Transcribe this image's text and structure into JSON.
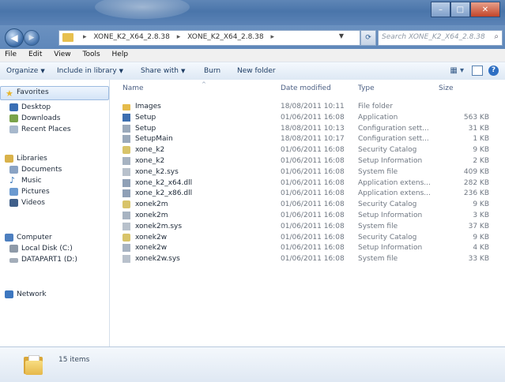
{
  "window": {
    "controls": {
      "minimize": "–",
      "maximize": "□",
      "close": "✕"
    }
  },
  "address": {
    "crumbs": [
      "XONE_K2_X64_2.8.38",
      "XONE_K2_X64_2.8.38"
    ],
    "search_placeholder": "Search XONE_K2_X64_2.8.38"
  },
  "menu": [
    "File",
    "Edit",
    "View",
    "Tools",
    "Help"
  ],
  "commands": {
    "organize": "Organize",
    "include_in_library": "Include in library",
    "share_with": "Share with",
    "burn": "Burn",
    "new_folder": "New folder"
  },
  "nav": {
    "favorites": "Favorites",
    "desktop": "Desktop",
    "downloads": "Downloads",
    "recent_places": "Recent Places",
    "libraries": "Libraries",
    "documents": "Documents",
    "music": "Music",
    "pictures": "Pictures",
    "videos": "Videos",
    "computer": "Computer",
    "local_disk": "Local Disk (C:)",
    "datapart": "DATAPART1 (D:)",
    "network": "Network"
  },
  "columns": {
    "name": "Name",
    "date": "Date modified",
    "type": "Type",
    "size": "Size"
  },
  "files": [
    {
      "name": "Images",
      "date": "18/08/2011 10:11",
      "type": "File folder",
      "size": "",
      "icon": "folder"
    },
    {
      "name": "Setup",
      "date": "01/06/2011 16:08",
      "type": "Application",
      "size": "563 KB",
      "icon": "application"
    },
    {
      "name": "Setup",
      "date": "18/08/2011 10:13",
      "type": "Configuration sett...",
      "size": "31 KB",
      "icon": "config"
    },
    {
      "name": "SetupMain",
      "date": "18/08/2011 10:17",
      "type": "Configuration sett...",
      "size": "1 KB",
      "icon": "config"
    },
    {
      "name": "xone_k2",
      "date": "01/06/2011 16:08",
      "type": "Security Catalog",
      "size": "9 KB",
      "icon": "catalog"
    },
    {
      "name": "xone_k2",
      "date": "01/06/2011 16:08",
      "type": "Setup Information",
      "size": "2 KB",
      "icon": "setupinfo"
    },
    {
      "name": "xone_k2.sys",
      "date": "01/06/2011 16:08",
      "type": "System file",
      "size": "409 KB",
      "icon": "sysfile"
    },
    {
      "name": "xone_k2_x64.dll",
      "date": "01/06/2011 16:08",
      "type": "Application extens...",
      "size": "282 KB",
      "icon": "dll"
    },
    {
      "name": "xone_k2_x86.dll",
      "date": "01/06/2011 16:08",
      "type": "Application extens...",
      "size": "236 KB",
      "icon": "dll"
    },
    {
      "name": "xonek2m",
      "date": "01/06/2011 16:08",
      "type": "Security Catalog",
      "size": "9 KB",
      "icon": "catalog"
    },
    {
      "name": "xonek2m",
      "date": "01/06/2011 16:08",
      "type": "Setup Information",
      "size": "3 KB",
      "icon": "setupinfo"
    },
    {
      "name": "xonek2m.sys",
      "date": "01/06/2011 16:08",
      "type": "System file",
      "size": "37 KB",
      "icon": "sysfile"
    },
    {
      "name": "xonek2w",
      "date": "01/06/2011 16:08",
      "type": "Security Catalog",
      "size": "9 KB",
      "icon": "catalog"
    },
    {
      "name": "xonek2w",
      "date": "01/06/2011 16:08",
      "type": "Setup Information",
      "size": "4 KB",
      "icon": "setupinfo"
    },
    {
      "name": "xonek2w.sys",
      "date": "01/06/2011 16:08",
      "type": "System file",
      "size": "33 KB",
      "icon": "sysfile"
    }
  ],
  "status": {
    "item_count": "15 items"
  },
  "colors": {
    "folder": "#e5bb4b",
    "application": "#3d6fb0",
    "config": "#9aa9bb",
    "catalog": "#d8c46a",
    "setupinfo": "#a7b3c2",
    "sysfile": "#b8c1cc",
    "dll": "#8fa0b6"
  }
}
